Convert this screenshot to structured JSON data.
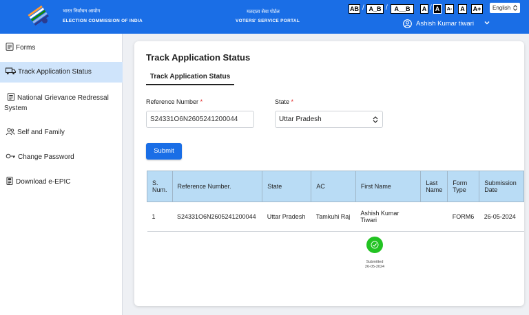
{
  "header": {
    "org_hindi": "भारत निर्वाचन आयोग",
    "org_english": "ELECTION COMMISSION OF INDIA",
    "portal_hindi": "मतदाता सेवा पोर्टल",
    "portal_english": "VOTERS' SERVICE PORTAL",
    "accessibility": [
      "AB",
      "A_B",
      "A__B",
      "A",
      "A",
      "A-",
      "A",
      "A+"
    ],
    "language": "English",
    "user_name": "Ashish Kumar tiwari",
    "brand_color": "#1a6ee6"
  },
  "sidebar": {
    "items": [
      {
        "label": "Forms",
        "icon": "form-icon"
      },
      {
        "label": "Track Application Status",
        "icon": "truck-icon"
      },
      {
        "label": "National Grievance Redressal",
        "label2": "System",
        "icon": "grievance-icon"
      },
      {
        "label": "Self and Family",
        "icon": "family-icon"
      },
      {
        "label": "Change Password",
        "icon": "key-icon"
      },
      {
        "label": "Download e-EPIC",
        "icon": "epic-card-icon"
      }
    ],
    "active": "Track Application Status"
  },
  "main": {
    "title": "Track Application Status",
    "tab": "Track Application Status",
    "reference_label": "Reference Number",
    "reference_value": "S24331O6N2605241200044",
    "state_label": "State",
    "state_value": "Uttar Pradesh",
    "required_mark": "*",
    "submit_label": "Submit",
    "table": {
      "headers": [
        "S. Num.",
        "Reference Number.",
        "State",
        "AC",
        "First Name",
        "Last Name",
        "Form Type",
        "Submission Date"
      ],
      "rows": [
        [
          "1",
          "S24331O6N2605241200044",
          "Uttar Pradesh",
          "Tamkuhi Raj",
          "Ashish Kumar Tiwari",
          "",
          "FORM6",
          "26-05-2024"
        ]
      ]
    },
    "status": {
      "label": "Submitted",
      "date": "26-05-2024",
      "color": "#22c322"
    }
  }
}
